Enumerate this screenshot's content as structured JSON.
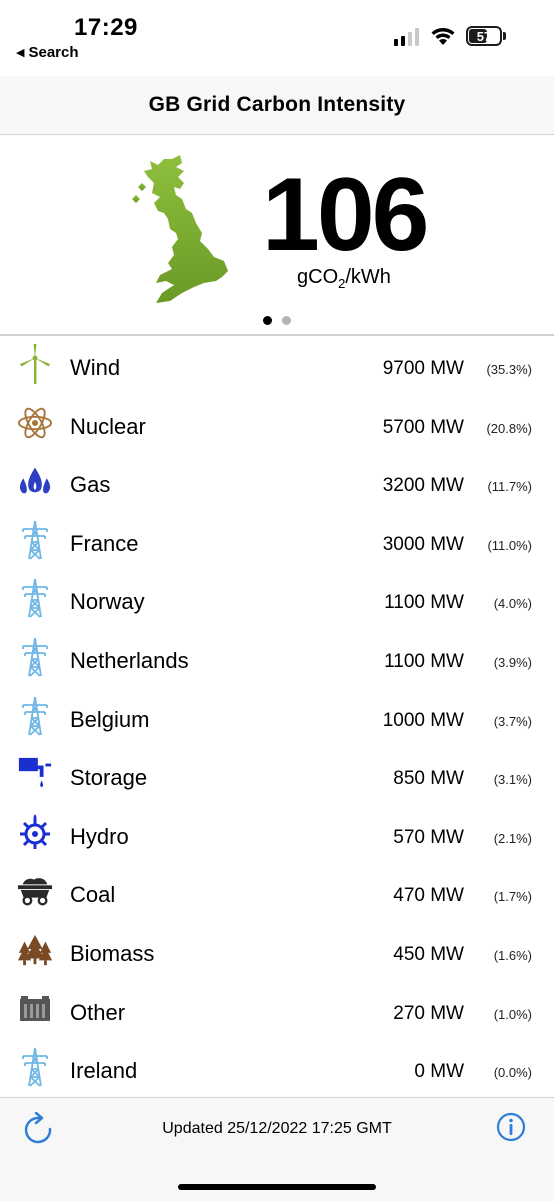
{
  "status_bar": {
    "time": "17:29",
    "back_label": "Search",
    "battery": "57"
  },
  "nav": {
    "title": "GB Grid Carbon Intensity"
  },
  "intensity": {
    "value": "106",
    "unit_prefix": "gCO",
    "unit_sub": "2",
    "unit_suffix": "/kWh",
    "page_count": 2,
    "active_page": 1
  },
  "sources": [
    {
      "name": "Wind",
      "mw": "9700 MW",
      "pct": "(35.3%)",
      "icon": "wind-turbine-icon",
      "color": "#8bb23a"
    },
    {
      "name": "Nuclear",
      "mw": "5700 MW",
      "pct": "(20.8%)",
      "icon": "atom-icon",
      "color": "#a8763a"
    },
    {
      "name": "Gas",
      "mw": "3200 MW",
      "pct": "(11.7%)",
      "icon": "flame-icon",
      "color": "#2f3fc4"
    },
    {
      "name": "France",
      "mw": "3000 MW",
      "pct": "(11.0%)",
      "icon": "pylon-icon",
      "color": "#6fb7e6"
    },
    {
      "name": "Norway",
      "mw": "1100 MW",
      "pct": "(4.0%)",
      "icon": "pylon-icon",
      "color": "#6fb7e6"
    },
    {
      "name": "Netherlands",
      "mw": "1100 MW",
      "pct": "(3.9%)",
      "icon": "pylon-icon",
      "color": "#6fb7e6"
    },
    {
      "name": "Belgium",
      "mw": "1000 MW",
      "pct": "(3.7%)",
      "icon": "pylon-icon",
      "color": "#6fb7e6"
    },
    {
      "name": "Storage",
      "mw": "850 MW",
      "pct": "(3.1%)",
      "icon": "tap-icon",
      "color": "#1a2fd0"
    },
    {
      "name": "Hydro",
      "mw": "570 MW",
      "pct": "(2.1%)",
      "icon": "water-wheel-icon",
      "color": "#1a2fd0"
    },
    {
      "name": "Coal",
      "mw": "470 MW",
      "pct": "(1.7%)",
      "icon": "coal-cart-icon",
      "color": "#2a2a2a"
    },
    {
      "name": "Biomass",
      "mw": "450 MW",
      "pct": "(1.6%)",
      "icon": "trees-icon",
      "color": "#7a4a24"
    },
    {
      "name": "Other",
      "mw": "270 MW",
      "pct": "(1.0%)",
      "icon": "battery-block-icon",
      "color": "#555555"
    },
    {
      "name": "Ireland",
      "mw": "0 MW",
      "pct": "(0.0%)",
      "icon": "pylon-icon",
      "color": "#6fb7e6"
    }
  ],
  "footer": {
    "updated": "Updated 25/12/2022 17:25 GMT",
    "accent": "#2f7ed8"
  }
}
